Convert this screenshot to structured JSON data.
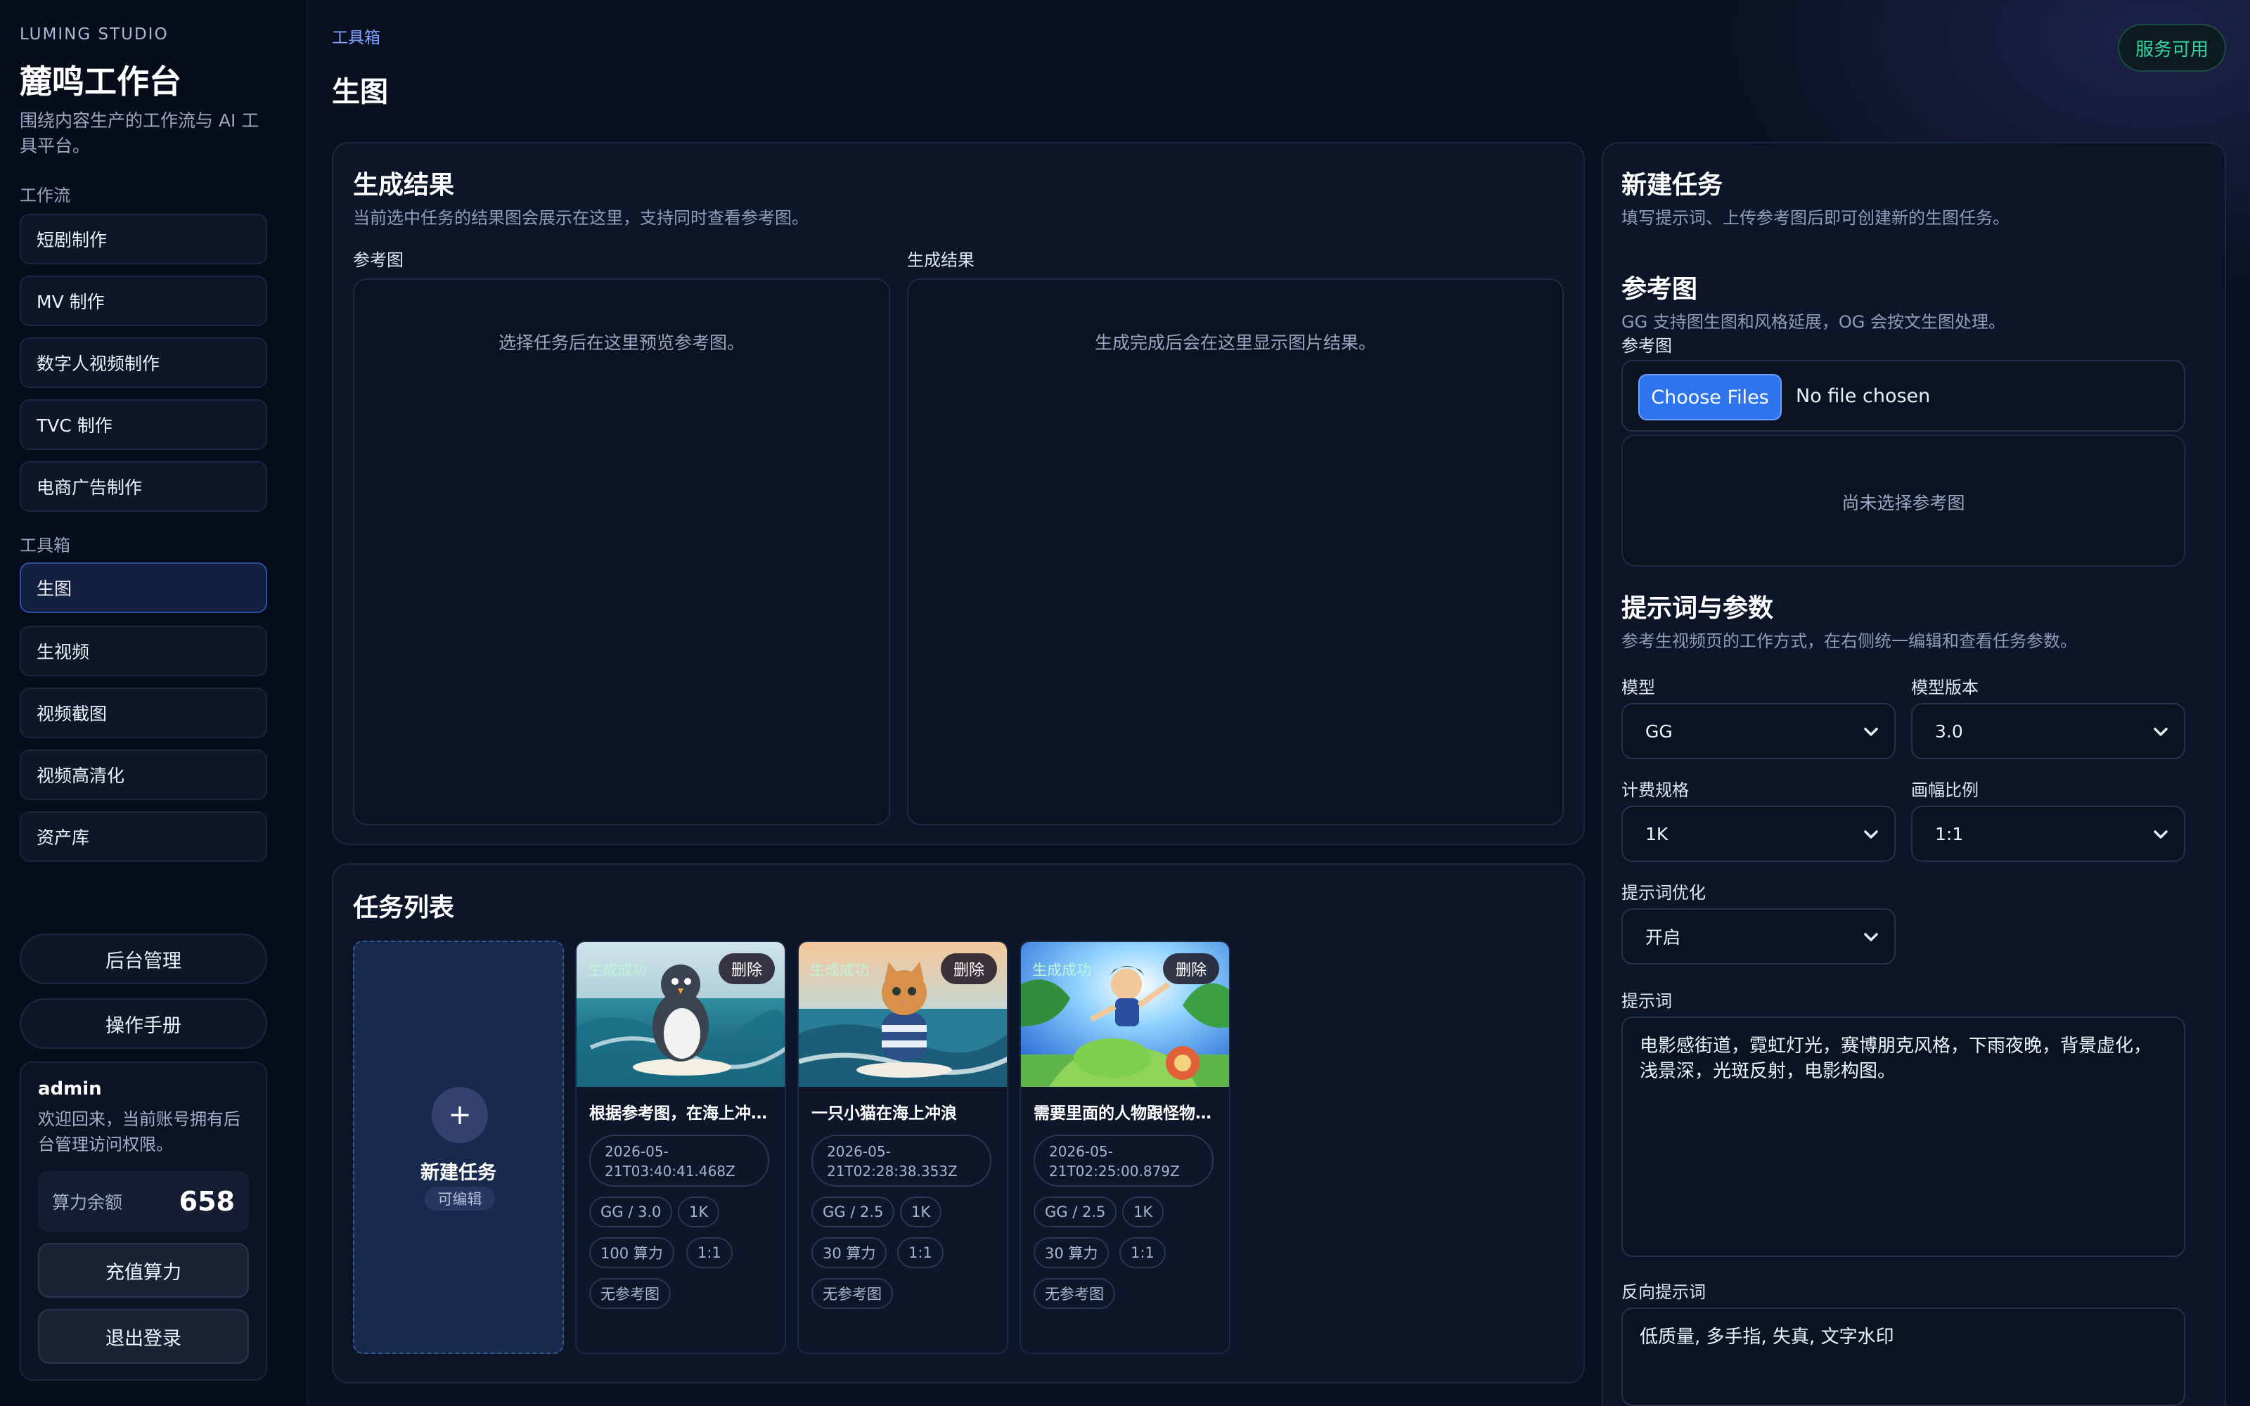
{
  "sidebar": {
    "brand_sub": "LUMING STUDIO",
    "brand_title": "麓鸣工作台",
    "brand_desc": "围绕内容生产的工作流与 AI 工具平台。",
    "workflow_label": "工作流",
    "workflow_items": [
      "短剧制作",
      "MV 制作",
      "数字人视频制作",
      "TVC 制作",
      "电商广告制作"
    ],
    "tools_label": "工具箱",
    "tool_items": [
      "生图",
      "生视频",
      "视频截图",
      "视频高清化",
      "资产库"
    ],
    "admin_button": "后台管理",
    "manual_button": "操作手册",
    "user": {
      "name": "admin",
      "desc": "欢迎回来，当前账号拥有后台管理访问权限。",
      "credit_label": "算力余额",
      "credit_value": "658",
      "recharge_button": "充值算力",
      "logout_button": "退出登录"
    }
  },
  "header": {
    "breadcrumb": "工具箱",
    "title": "生图",
    "status": "服务可用"
  },
  "results": {
    "title": "生成结果",
    "subtitle": "当前选中任务的结果图会展示在这里，支持同时查看参考图。",
    "ref_label": "参考图",
    "ref_placeholder": "选择任务后在这里预览参考图。",
    "out_label": "生成结果",
    "out_placeholder": "生成完成后会在这里显示图片结果。"
  },
  "tasks": {
    "title": "任务列表",
    "new_title": "新建任务",
    "new_tag": "可编辑",
    "new_icon": "plus-icon",
    "items": [
      {
        "status": "生成成功",
        "delete": "删除",
        "title": "根据参考图，在海上冲浪的企鹅",
        "time": "2026-05-21T03:40:41.468Z",
        "model": "GG / 3.0",
        "spec": "1K",
        "cost": "100 算力",
        "ratio": "1:1",
        "ref": "无参考图"
      },
      {
        "status": "生成成功",
        "delete": "删除",
        "title": "一只小猫在海上冲浪",
        "time": "2026-05-21T02:28:38.353Z",
        "model": "GG / 2.5",
        "spec": "1K",
        "cost": "30 算力",
        "ratio": "1:1",
        "ref": "无参考图"
      },
      {
        "status": "生成成功",
        "delete": "删除",
        "title": "需要里面的人物跟怪物在冒险",
        "time": "2026-05-21T02:25:00.879Z",
        "model": "GG / 2.5",
        "spec": "1K",
        "cost": "30 算力",
        "ratio": "1:1",
        "ref": "无参考图"
      }
    ]
  },
  "form": {
    "title": "新建任务",
    "subtitle": "填写提示词、上传参考图后即可创建新的生图任务。",
    "ref_section_title": "参考图",
    "ref_section_desc": "GG 支持图生图和风格延展，OG 会按文生图处理。",
    "ref_field_label": "参考图",
    "choose_files": "Choose Files",
    "no_file": "No file chosen",
    "no_ref_placeholder": "尚未选择参考图",
    "params_title": "提示词与参数",
    "params_desc": "参考生视频页的工作方式，在右侧统一编辑和查看任务参数。",
    "model_label": "模型",
    "model_value": "GG",
    "version_label": "模型版本",
    "version_value": "3.0",
    "spec_label": "计费规格",
    "spec_value": "1K",
    "ratio_label": "画幅比例",
    "ratio_value": "1:1",
    "optimize_label": "提示词优化",
    "optimize_value": "开启",
    "prompt_label": "提示词",
    "prompt_value": "电影感街道，霓虹灯光，赛博朋克风格，下雨夜晚，背景虚化，浅景深，光斑反射，电影构图。",
    "negative_label": "反向提示词",
    "negative_value": "低质量, 多手指, 失真, 文字水印"
  }
}
